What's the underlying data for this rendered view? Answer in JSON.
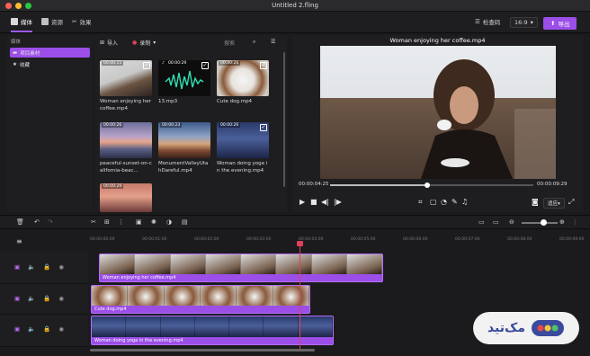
{
  "window": {
    "title": "Untitled 2.fling"
  },
  "colors": {
    "accent": "#9b4ee8",
    "playhead": "#e0405a",
    "bg": "#1b1b1d"
  },
  "topbar": {
    "tabs": [
      {
        "label": "媒体",
        "icon": "media-icon",
        "active": true
      },
      {
        "label": "资源",
        "icon": "resources-icon",
        "active": false
      },
      {
        "label": "效果",
        "icon": "effects-icon",
        "active": false
      }
    ],
    "activate_label": "检查码",
    "ratio_value": "16:9",
    "export_label": "导出"
  },
  "sidebar": {
    "header": "媒体",
    "items": [
      {
        "label": "项目素材",
        "icon": "folder-icon",
        "selected": true
      },
      {
        "label": "收藏",
        "icon": "star-icon",
        "selected": false
      }
    ]
  },
  "media": {
    "import_label": "导入",
    "record_label": "录制",
    "search_placeholder": "搜索",
    "items": [
      {
        "name": "Woman enjoying her coffee.mp4",
        "time": "00:00:15",
        "checked": true
      },
      {
        "name": "13.mp3",
        "time": "00:00:29",
        "checked": true
      },
      {
        "name": "Cute dog.mp4",
        "time": "00:00:26",
        "checked": true
      },
      {
        "name": "peaceful-sunset-on-california-beac...",
        "time": "00:00:26",
        "checked": false
      },
      {
        "name": "MonumentValleyUtahDareful.mp4",
        "time": "00:00:23",
        "checked": false
      },
      {
        "name": "Woman doing yoga in the evening.mp4",
        "time": "00:00:26",
        "checked": true
      },
      {
        "name": "",
        "time": "00:00:29",
        "checked": false
      }
    ]
  },
  "preview": {
    "title": "Woman enjoying her coffee.mp4",
    "current_time": "00:00:04:25",
    "total_time": "00:00:09:29",
    "progress": 0.48,
    "quality_label": "适应"
  },
  "timeline": {
    "ruler": [
      "00:00:00:00",
      "00:00:01:00",
      "00:00:02:00",
      "00:00:03:00",
      "00:00:04:00",
      "00:00:05:00",
      "00:00:06:00",
      "00:00:07:00",
      "00:00:08:00",
      "00:00:09:00"
    ],
    "clips": [
      {
        "name": "Woman enjoying her coffee.mp4"
      },
      {
        "name": "Cute dog.mp4"
      },
      {
        "name": "Woman doing yoga in the evening.mp4"
      }
    ]
  },
  "watermark": {
    "text": "مک‌تید"
  }
}
